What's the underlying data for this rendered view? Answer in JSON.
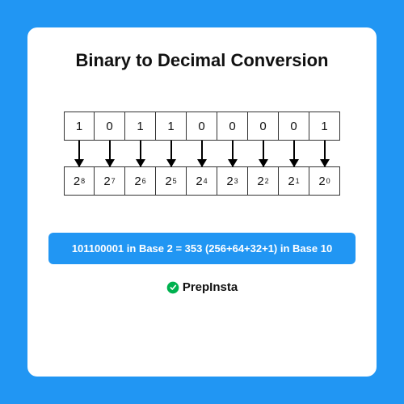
{
  "title": "Binary to Decimal Conversion",
  "binary_digits": [
    "1",
    "0",
    "1",
    "1",
    "0",
    "0",
    "0",
    "0",
    "1"
  ],
  "powers": [
    "8",
    "7",
    "6",
    "5",
    "4",
    "3",
    "2",
    "1",
    "0"
  ],
  "power_base": "2",
  "result_text": "101100001 in Base 2 = 353 (256+64+32+1) in Base 10",
  "brand": "PrepInsta",
  "colors": {
    "accent": "#2196f3",
    "brand_green": "#00b14f"
  }
}
